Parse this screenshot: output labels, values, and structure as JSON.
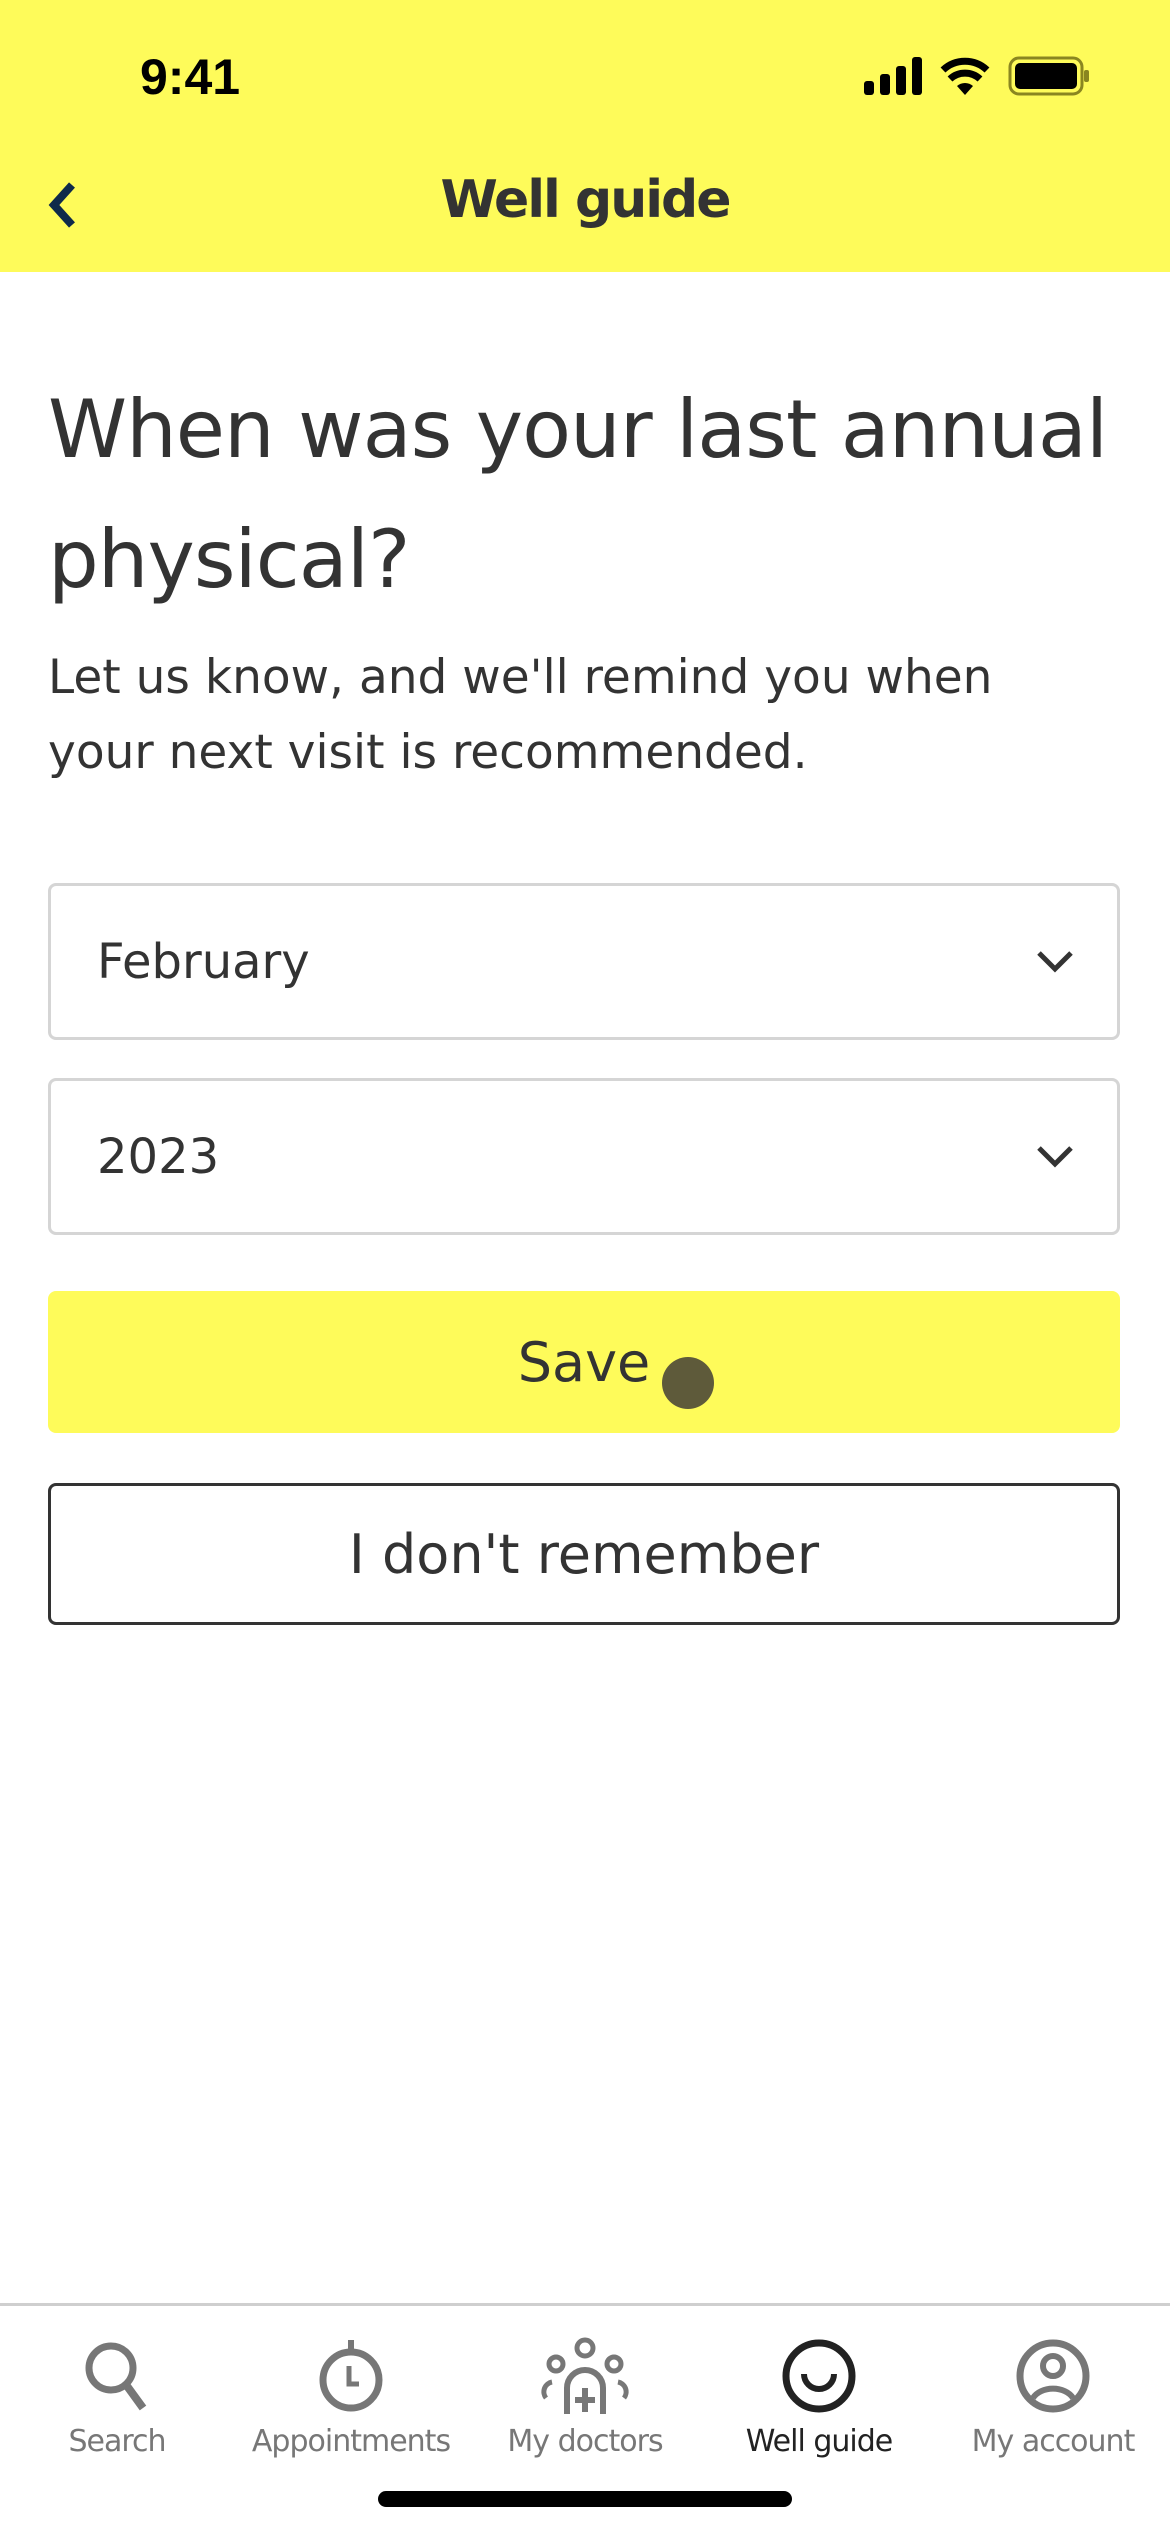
{
  "status_bar": {
    "time": "9:41",
    "icons": [
      "signal-icon",
      "wifi-icon",
      "battery-icon"
    ]
  },
  "header": {
    "title": "Well guide",
    "back_icon": "chevron-left-icon"
  },
  "main": {
    "heading": "When was your last annual physical?",
    "subtitle": "Let us know, and we'll remind you when your next visit is recommended.",
    "month_select": {
      "value": "February"
    },
    "year_select": {
      "value": "2023"
    },
    "save_label": "Save",
    "dont_remember_label": "I don't remember"
  },
  "tabs": [
    {
      "label": "Search",
      "icon": "search-icon"
    },
    {
      "label": "Appointments",
      "icon": "stopwatch-icon"
    },
    {
      "label": "My doctors",
      "icon": "doctors-icon"
    },
    {
      "label": "Well guide",
      "icon": "smile-icon",
      "active": true
    },
    {
      "label": "My account",
      "icon": "account-icon"
    }
  ],
  "colors": {
    "brand_yellow": "#fefb5a",
    "text": "#333333",
    "inactive_tab": "#777777"
  }
}
